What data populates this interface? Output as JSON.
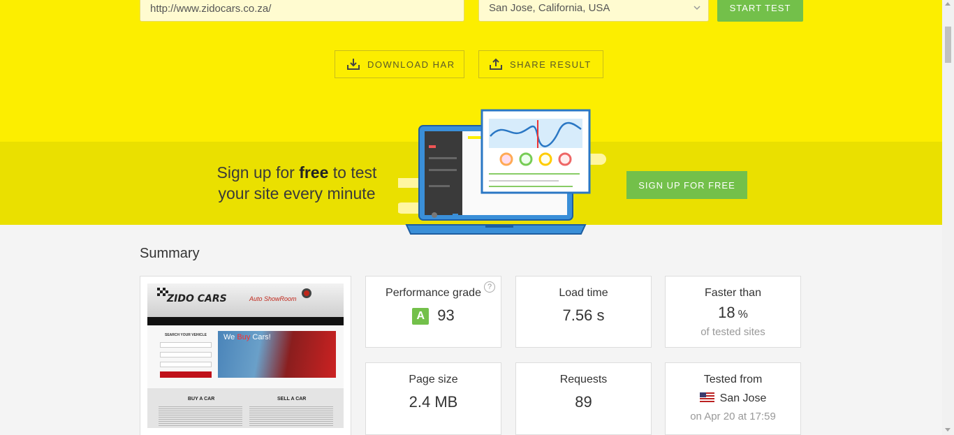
{
  "test_form": {
    "url_value": "http://www.zidocars.co.za/",
    "location_value": "San Jose, California, USA",
    "start_label": "START TEST"
  },
  "actions": {
    "download_label": "DOWNLOAD HAR",
    "share_label": "SHARE RESULT"
  },
  "signup": {
    "line1_pre": "Sign up for ",
    "line1_bold": "free",
    "line1_post": " to test",
    "line2": "your site every minute",
    "button_label": "SIGN UP FOR FREE"
  },
  "summary": {
    "title": "Summary",
    "performance": {
      "label": "Performance grade",
      "grade": "A",
      "score": "93",
      "help": "?"
    },
    "load_time": {
      "label": "Load time",
      "value": "7.56 s"
    },
    "faster_than": {
      "label": "Faster than",
      "value": "18",
      "unit": "%",
      "sub": "of tested sites"
    },
    "page_size": {
      "label": "Page size",
      "value": "2.4 MB"
    },
    "requests": {
      "label": "Requests",
      "value": "89"
    },
    "tested_from": {
      "label": "Tested from",
      "location": "San Jose",
      "when": "on Apr 20 at 17:59"
    }
  },
  "site_preview": {
    "logo": "ZIDO CARS",
    "logo2": "Auto ShowRoom",
    "search_title": "SEARCH YOUR VEHICLE",
    "hero_pre": "We ",
    "hero_accent": "Buy",
    "hero_post": " Cars!",
    "buy_title": "BUY A CAR",
    "sell_title": "SELL A CAR"
  },
  "colors": {
    "brand_yellow": "#fcee00",
    "band_yellow": "#eae000",
    "accent_green": "#73c04a"
  }
}
